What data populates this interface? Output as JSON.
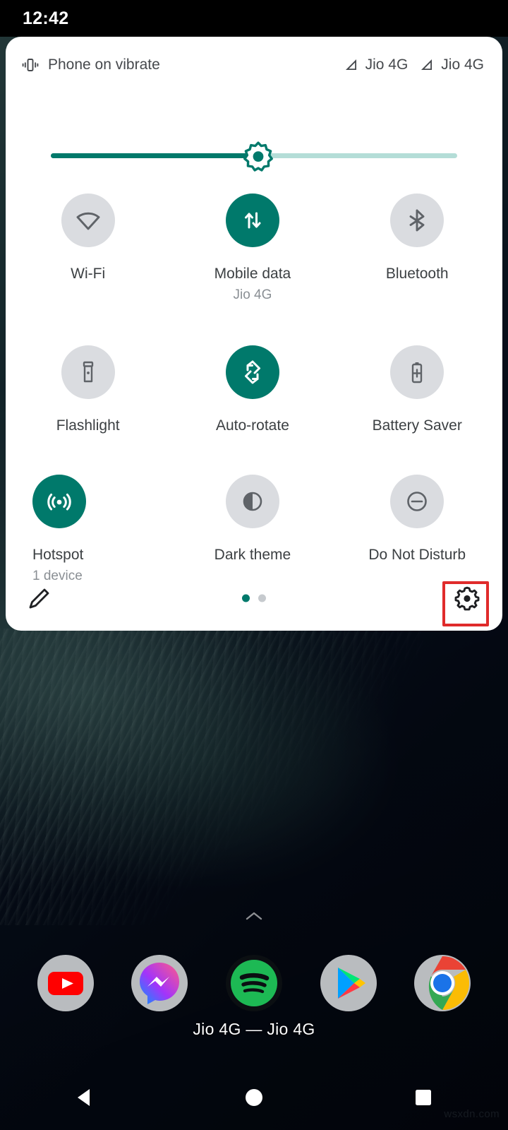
{
  "colors": {
    "accent": "#00796b",
    "tile_off_bg": "#dadce0",
    "tile_icon_off": "#5f6368",
    "label": "#3c4043",
    "sublabel": "#8a8f94",
    "panel_bg": "#ffffff",
    "annotation": "#e02b2b",
    "statusbar_bg": "#000000"
  },
  "statusbar": {
    "time": "12:42"
  },
  "qs_panel": {
    "header": {
      "ringer_icon": "vibrate-icon",
      "ringer_text": "Phone on vibrate",
      "sims": [
        {
          "icon": "signal-bar-icon",
          "label": "Jio 4G"
        },
        {
          "icon": "signal-bar-icon",
          "label": "Jio 4G"
        }
      ]
    },
    "brightness": {
      "icon": "brightness-sun-icon",
      "value_percent": 51
    },
    "tiles": [
      [
        {
          "label": "Wi-Fi",
          "sub": "",
          "icon": "wifi-icon",
          "state": "off",
          "align": "center"
        },
        {
          "label": "Mobile data",
          "sub": "Jio 4G",
          "icon": "mobile-data-icon",
          "state": "on",
          "align": "center"
        },
        {
          "label": "Bluetooth",
          "sub": "",
          "icon": "bluetooth-icon",
          "state": "off",
          "align": "center"
        }
      ],
      [
        {
          "label": "Flashlight",
          "sub": "",
          "icon": "flashlight-icon",
          "state": "off",
          "align": "center"
        },
        {
          "label": "Auto-rotate",
          "sub": "",
          "icon": "auto-rotate-icon",
          "state": "on",
          "align": "center"
        },
        {
          "label": "Battery Saver",
          "sub": "",
          "icon": "battery-saver-icon",
          "state": "off",
          "align": "center"
        }
      ],
      [
        {
          "label": "Hotspot",
          "sub": "1 device",
          "icon": "hotspot-icon",
          "state": "on",
          "align": "left"
        },
        {
          "label": "Dark theme",
          "sub": "",
          "icon": "dark-theme-icon",
          "state": "off",
          "align": "center"
        },
        {
          "label": "Do Not Disturb",
          "sub": "",
          "icon": "do-not-disturb-icon",
          "state": "off",
          "align": "center"
        }
      ]
    ],
    "footer": {
      "edit_icon": "pencil-edit-icon",
      "settings_icon": "gear-icon",
      "pages": 2,
      "active_page": 1
    }
  },
  "annotation": {
    "target": "gear-icon",
    "shape": "rectangle"
  },
  "home": {
    "drawer_arrow_icon": "chevron-up-icon",
    "dock": [
      {
        "name": "YouTube",
        "icon": "youtube-icon"
      },
      {
        "name": "Messenger",
        "icon": "messenger-icon"
      },
      {
        "name": "Spotify",
        "icon": "spotify-icon"
      },
      {
        "name": "Play Store",
        "icon": "play-store-icon"
      },
      {
        "name": "Chrome",
        "icon": "chrome-icon"
      }
    ],
    "carrier_text": "Jio 4G — Jio 4G",
    "watermark": "wsxdn.com"
  },
  "navbar": {
    "items": [
      {
        "name": "Back",
        "icon": "back-triangle-icon"
      },
      {
        "name": "Home",
        "icon": "home-circle-icon"
      },
      {
        "name": "Recents",
        "icon": "recents-square-icon"
      }
    ]
  }
}
